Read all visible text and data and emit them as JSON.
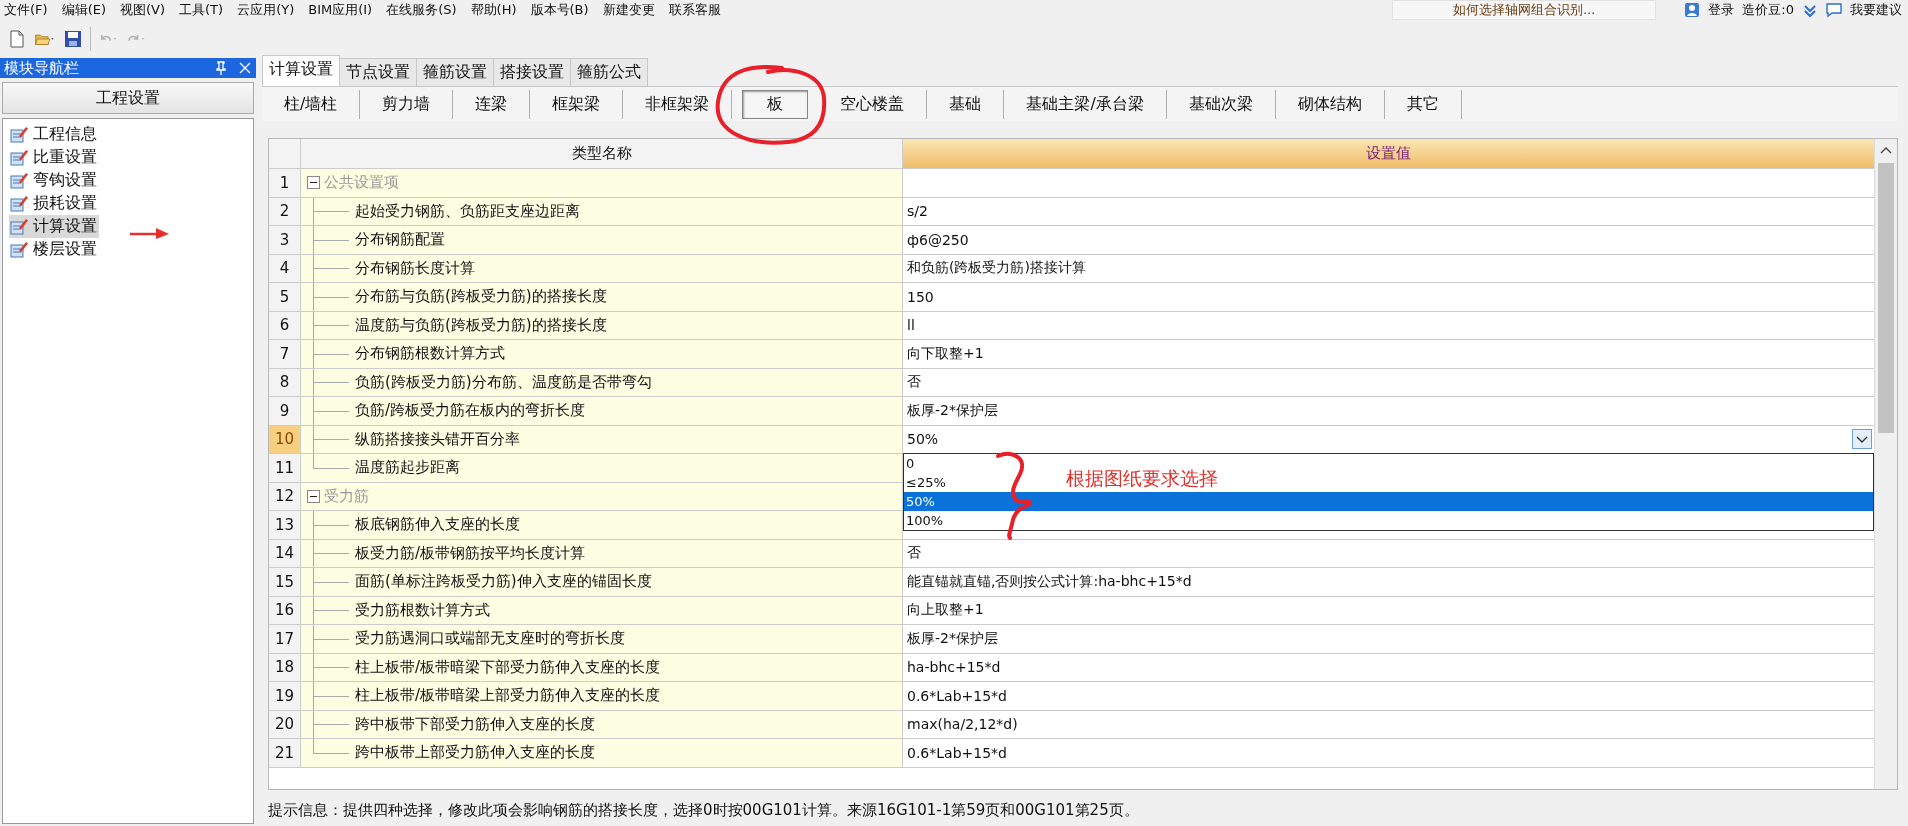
{
  "menu": [
    {
      "label": "文件(F)"
    },
    {
      "label": "编辑(E)"
    },
    {
      "label": "视图(V)"
    },
    {
      "label": "工具(T)"
    },
    {
      "label": "云应用(Y)"
    },
    {
      "label": "BIM应用(I)"
    },
    {
      "label": "在线服务(S)"
    },
    {
      "label": "帮助(H)"
    },
    {
      "label": "版本号(B)"
    },
    {
      "label": "新建变更"
    },
    {
      "label": "联系客服"
    }
  ],
  "top_right": {
    "hint": "如何选择轴网组合识别...",
    "login": "登录",
    "beans": "造价豆:0",
    "suggest": "我要建议"
  },
  "toolbar": [
    {
      "kind": "new",
      "disabled": false
    },
    {
      "kind": "open",
      "disabled": false
    },
    {
      "kind": "save",
      "disabled": false
    },
    {
      "kind": "undo",
      "disabled": true
    },
    {
      "kind": "redo",
      "disabled": true
    }
  ],
  "sidebar": {
    "title": "模块导航栏",
    "section": "工程设置",
    "items": [
      {
        "label": "工程信息",
        "selected": false
      },
      {
        "label": "比重设置",
        "selected": false
      },
      {
        "label": "弯钩设置",
        "selected": false
      },
      {
        "label": "损耗设置",
        "selected": false
      },
      {
        "label": "计算设置",
        "selected": true
      },
      {
        "label": "楼层设置",
        "selected": false
      }
    ]
  },
  "tabs": [
    {
      "label": "计算设置",
      "selected": true
    },
    {
      "label": "节点设置",
      "selected": false
    },
    {
      "label": "箍筋设置",
      "selected": false
    },
    {
      "label": "搭接设置",
      "selected": false
    },
    {
      "label": "箍筋公式",
      "selected": false
    }
  ],
  "subtabs": [
    {
      "label": "柱/墙柱",
      "selected": false
    },
    {
      "label": "剪力墙",
      "selected": false
    },
    {
      "label": "连梁",
      "selected": false
    },
    {
      "label": "框架梁",
      "selected": false
    },
    {
      "label": "非框架梁",
      "selected": false
    },
    {
      "label": "板",
      "selected": true
    },
    {
      "label": "空心楼盖",
      "selected": false
    },
    {
      "label": "基础",
      "selected": false
    },
    {
      "label": "基础主梁/承台梁",
      "selected": false
    },
    {
      "label": "基础次梁",
      "selected": false
    },
    {
      "label": "砌体结构",
      "selected": false
    },
    {
      "label": "其它",
      "selected": false
    }
  ],
  "table": {
    "columns": [
      "类型名称",
      "设置值"
    ],
    "rows": [
      {
        "num": "1",
        "name": "公共设置项",
        "expanded": true,
        "selected": false,
        "children": [
          {
            "num": "2",
            "name": "起始受力钢筋、负筋距支座边距离",
            "value": "s/2",
            "selected": false
          },
          {
            "num": "3",
            "name": "分布钢筋配置",
            "value": "ф6@250",
            "selected": false
          },
          {
            "num": "4",
            "name": "分布钢筋长度计算",
            "value": "和负筋(跨板受力筋)搭接计算",
            "selected": false
          },
          {
            "num": "5",
            "name": "分布筋与负筋(跨板受力筋)的搭接长度",
            "value": "150",
            "selected": false
          },
          {
            "num": "6",
            "name": "温度筋与负筋(跨板受力筋)的搭接长度",
            "value": "ll",
            "selected": false
          },
          {
            "num": "7",
            "name": "分布钢筋根数计算方式",
            "value": "向下取整+1",
            "selected": false
          },
          {
            "num": "8",
            "name": "负筋(跨板受力筋)分布筋、温度筋是否带弯勾",
            "value": "否",
            "selected": false
          },
          {
            "num": "9",
            "name": "负筋/跨板受力筋在板内的弯折长度",
            "value": "板厚-2*保护层",
            "selected": false
          },
          {
            "num": "10",
            "name": "纵筋搭接接头错开百分率",
            "value": "50%",
            "selected": true,
            "dropdown": {
              "open": true,
              "options": [
                {
                  "label": "0",
                  "selected": false
                },
                {
                  "label": "≤25%",
                  "selected": false
                },
                {
                  "label": "50%",
                  "selected": true
                },
                {
                  "label": "100%",
                  "selected": false
                }
              ]
            }
          },
          {
            "num": "11",
            "name": "温度筋起步距离",
            "selected": false
          }
        ]
      },
      {
        "num": "12",
        "name": "受力筋",
        "expanded": true,
        "selected": false,
        "children": [
          {
            "num": "13",
            "name": "板底钢筋伸入支座的长度",
            "selected": false
          },
          {
            "num": "14",
            "name": "板受力筋/板带钢筋按平均长度计算",
            "value": "否",
            "selected": false
          },
          {
            "num": "15",
            "name": "面筋(单标注跨板受力筋)伸入支座的锚固长度",
            "value": "能直锚就直锚,否则按公式计算:ha-bhc+15*d",
            "selected": false
          },
          {
            "num": "16",
            "name": "受力筋根数计算方式",
            "value": "向上取整+1",
            "selected": false
          },
          {
            "num": "17",
            "name": "受力筋遇洞口或端部无支座时的弯折长度",
            "value": "板厚-2*保护层",
            "selected": false
          },
          {
            "num": "18",
            "name": "柱上板带/板带暗梁下部受力筋伸入支座的长度",
            "value": "ha-bhc+15*d",
            "selected": false
          },
          {
            "num": "19",
            "name": "柱上板带/板带暗梁上部受力筋伸入支座的长度",
            "value": "0.6*Lab+15*d",
            "selected": false
          },
          {
            "num": "20",
            "name": "跨中板带下部受力筋伸入支座的长度",
            "value": "max(ha/2,12*d)",
            "selected": false
          },
          {
            "num": "21",
            "name": "跨中板带上部受力筋伸入支座的长度",
            "value": "0.6*Lab+15*d",
            "selected": false
          }
        ]
      }
    ]
  },
  "annotation": {
    "text": "根据图纸要求选择"
  },
  "status_bar": "提示信息：提供四种选择，修改此项会影响钢筋的搭接长度，选择0时按00G101计算。来源16G101-1第59页和00G101第25页。"
}
